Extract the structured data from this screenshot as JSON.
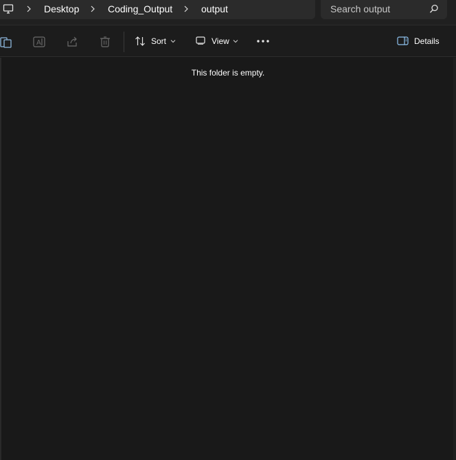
{
  "breadcrumb": {
    "items": [
      "Desktop",
      "Coding_Output",
      "output"
    ]
  },
  "search": {
    "placeholder": "Search output"
  },
  "toolbar": {
    "sort_label": "Sort",
    "view_label": "View",
    "details_label": "Details"
  },
  "content": {
    "empty_message": "This folder is empty."
  },
  "icons": {
    "pc": "this-pc-icon",
    "chevron_right": "chevron-right-icon",
    "search": "search-icon",
    "paste": "paste-icon",
    "rename": "rename-icon",
    "share": "share-icon",
    "delete": "delete-icon",
    "sort": "sort-icon",
    "view": "view-icon",
    "more": "more-options-icon",
    "details": "details-pane-icon"
  },
  "colors": {
    "background": "#191919",
    "bar": "#202020",
    "field": "#2b2b2b",
    "text": "#ffffff",
    "disabled_icon": "#6b6b6b"
  }
}
